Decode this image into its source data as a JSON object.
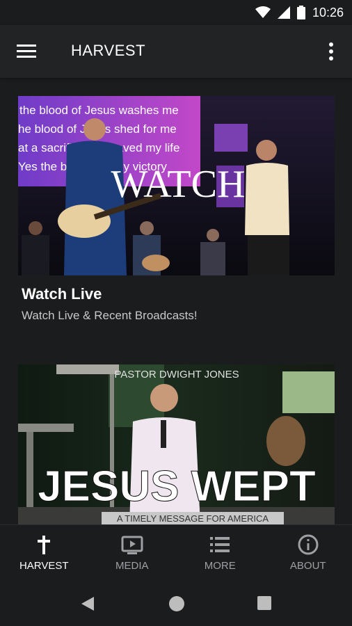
{
  "status_bar": {
    "time": "10:26"
  },
  "app_bar": {
    "title": "HARVEST"
  },
  "cards": [
    {
      "overlay_text": "WATCH",
      "lyrics": [
        "the blood of Jesus washes me",
        "he blood of Jesus shed for me",
        "at a sacrifice that saved my life",
        "Yes the blood it is my victory"
      ],
      "title": "Watch Live",
      "subtitle": "Watch Live & Recent Broadcasts!"
    },
    {
      "top_text": "PASTOR DWIGHT JONES",
      "headline": "JESUS WEPT",
      "tagline": "A TIMELY MESSAGE FOR AMERICA"
    }
  ],
  "bottom_nav": [
    {
      "label": "HARVEST",
      "icon": "cross-icon",
      "active": true
    },
    {
      "label": "MEDIA",
      "icon": "tv-play-icon",
      "active": false
    },
    {
      "label": "MORE",
      "icon": "list-icon",
      "active": false
    },
    {
      "label": "ABOUT",
      "icon": "info-icon",
      "active": false
    }
  ],
  "colors": {
    "background": "#1b1c1e",
    "app_bar": "#222325",
    "active": "#ffffff",
    "inactive": "#9ea0a4"
  }
}
